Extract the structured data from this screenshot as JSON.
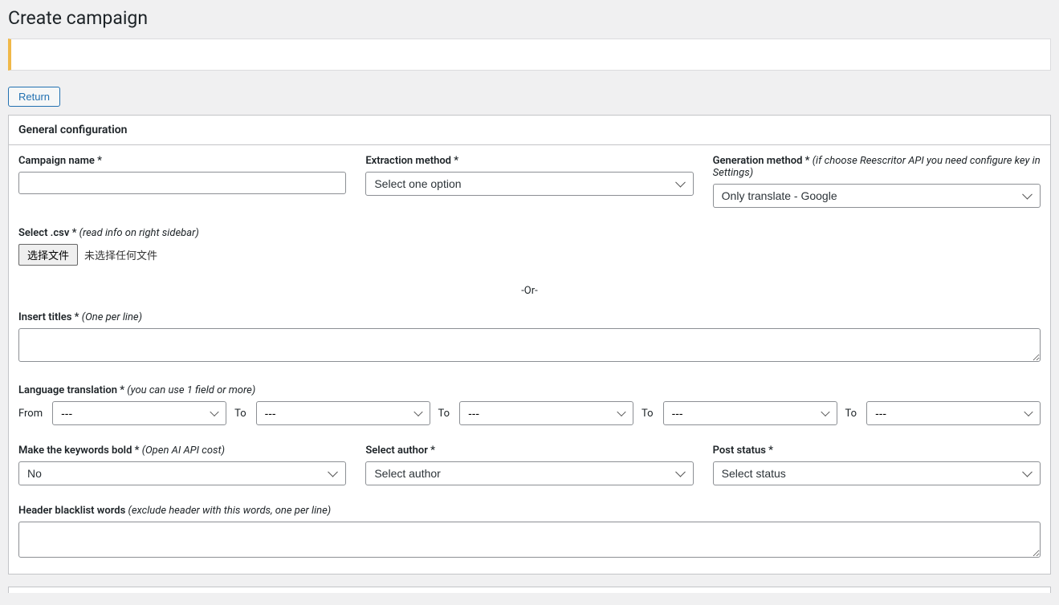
{
  "pageTitle": "Create campaign",
  "returnButton": "Return",
  "panel": {
    "title": "General configuration",
    "campaignName": {
      "label": "Campaign name *"
    },
    "extractionMethod": {
      "label": "Extraction method *",
      "placeholder": "Select one option"
    },
    "generationMethod": {
      "label": "Generation method * ",
      "hint": "(if choose Reescritor API you need configure key in Settings)",
      "selected": "Only translate - Google"
    },
    "selectCsv": {
      "label": "Select .csv * ",
      "hint": "(read info on right sidebar)",
      "button": "选择文件",
      "status": "未选择任何文件"
    },
    "orText": "-Or-",
    "insertTitles": {
      "label": "Insert titles * ",
      "hint": "(One per line)"
    },
    "languageTranslation": {
      "label": "Language translation * ",
      "hint": "(you can use 1 field or more)",
      "fromLabel": "From",
      "toLabel": "To",
      "placeholder": "---"
    },
    "keywordsBold": {
      "label": "Make the keywords bold * ",
      "hint": "(Open AI API cost)",
      "selected": "No"
    },
    "selectAuthor": {
      "label": "Select author *",
      "placeholder": "Select author"
    },
    "postStatus": {
      "label": "Post status *",
      "placeholder": "Select status"
    },
    "headerBlacklist": {
      "label": "Header blacklist words ",
      "hint": "(exclude header with this words, one per line)"
    }
  }
}
